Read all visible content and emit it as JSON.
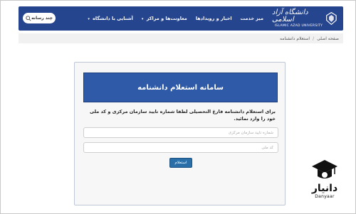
{
  "nav": {
    "logo_name": "دانشگاه آزاد اسلامی",
    "logo_en": "ISLAMIC AZAD UNIVERSITY",
    "items": [
      {
        "label": "آشنایی با دانشگاه",
        "caret": "▾"
      },
      {
        "label": "معاونت‌ها و مراکز",
        "caret": "▾"
      },
      {
        "label": "اخبار و رویدادها",
        "caret": ""
      },
      {
        "label": "میز خدمت",
        "caret": ""
      }
    ],
    "search_label": "چند رسانه",
    "colors": {
      "bar": "#26458f"
    }
  },
  "breadcrumb": {
    "items": [
      "صفحه اصلی",
      "استعلام دانشنامه"
    ],
    "separator": "/"
  },
  "form": {
    "title": "سامانه استعلام دانشنامه",
    "instruction": "برای استعلام دانشنامه فارغ التحصیلی لطفا شماره تایید سازمان مرکزی و کد ملی خود را وارد نمائید.",
    "field1_placeholder": "شماره تایید سازمان مرکزی",
    "field2_placeholder": "کد ملی",
    "submit_label": "استعلام",
    "colors": {
      "header": "#2f5aa8",
      "button": "#2a6fa8"
    }
  },
  "watermark": {
    "name": "دانیار",
    "en": "Danyaar"
  }
}
